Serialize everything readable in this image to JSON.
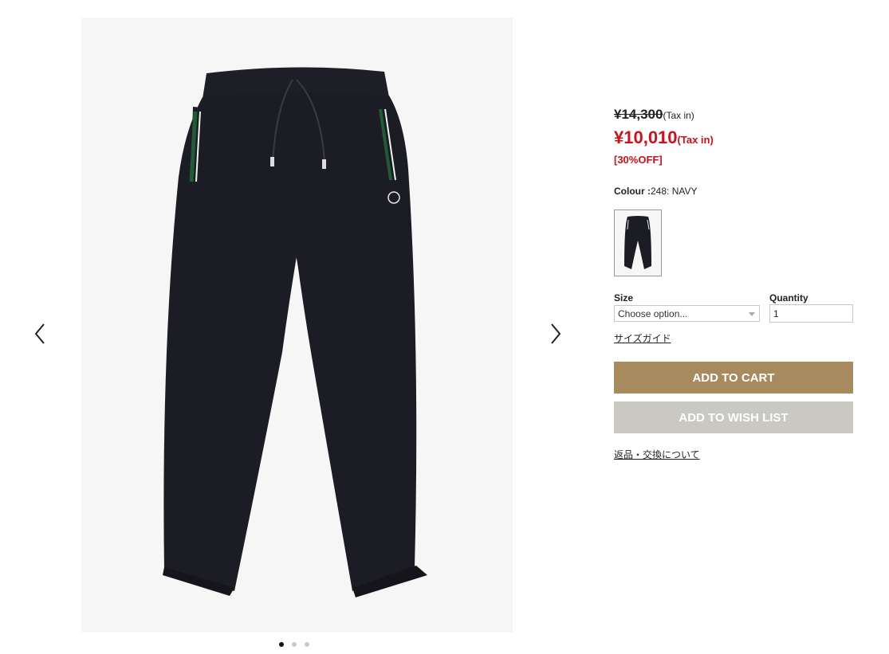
{
  "gallery": {
    "image_alt": "navy sweatpants product photo",
    "prev_icon": "chevron-left-icon",
    "next_icon": "chevron-right-icon",
    "slides": 3,
    "active_slide": 1
  },
  "product": {
    "original_price": "¥14,300",
    "original_price_tax": "(Tax in)",
    "sale_price": "¥10,010",
    "sale_price_tax": "(Tax in)",
    "discount": "[30%OFF]",
    "colour_label": "Colour :",
    "colour_value": "248: NAVY",
    "swatch_icon": "navy-pants-thumbnail"
  },
  "form": {
    "size_label": "Size",
    "size_selected": "Choose option...",
    "quantity_label": "Quantity",
    "quantity_value": "1",
    "size_guide": "サイズガイド"
  },
  "actions": {
    "add_to_cart": "ADD TO CART",
    "add_to_wishlist": "ADD TO WISH LIST",
    "returns_link": "返品・交換について"
  },
  "colors": {
    "sale_red": "#d0111b",
    "cart_button": "#a78b5f",
    "wishlist_button": "#c9c8c3",
    "product_navy": "#1c1c24"
  }
}
